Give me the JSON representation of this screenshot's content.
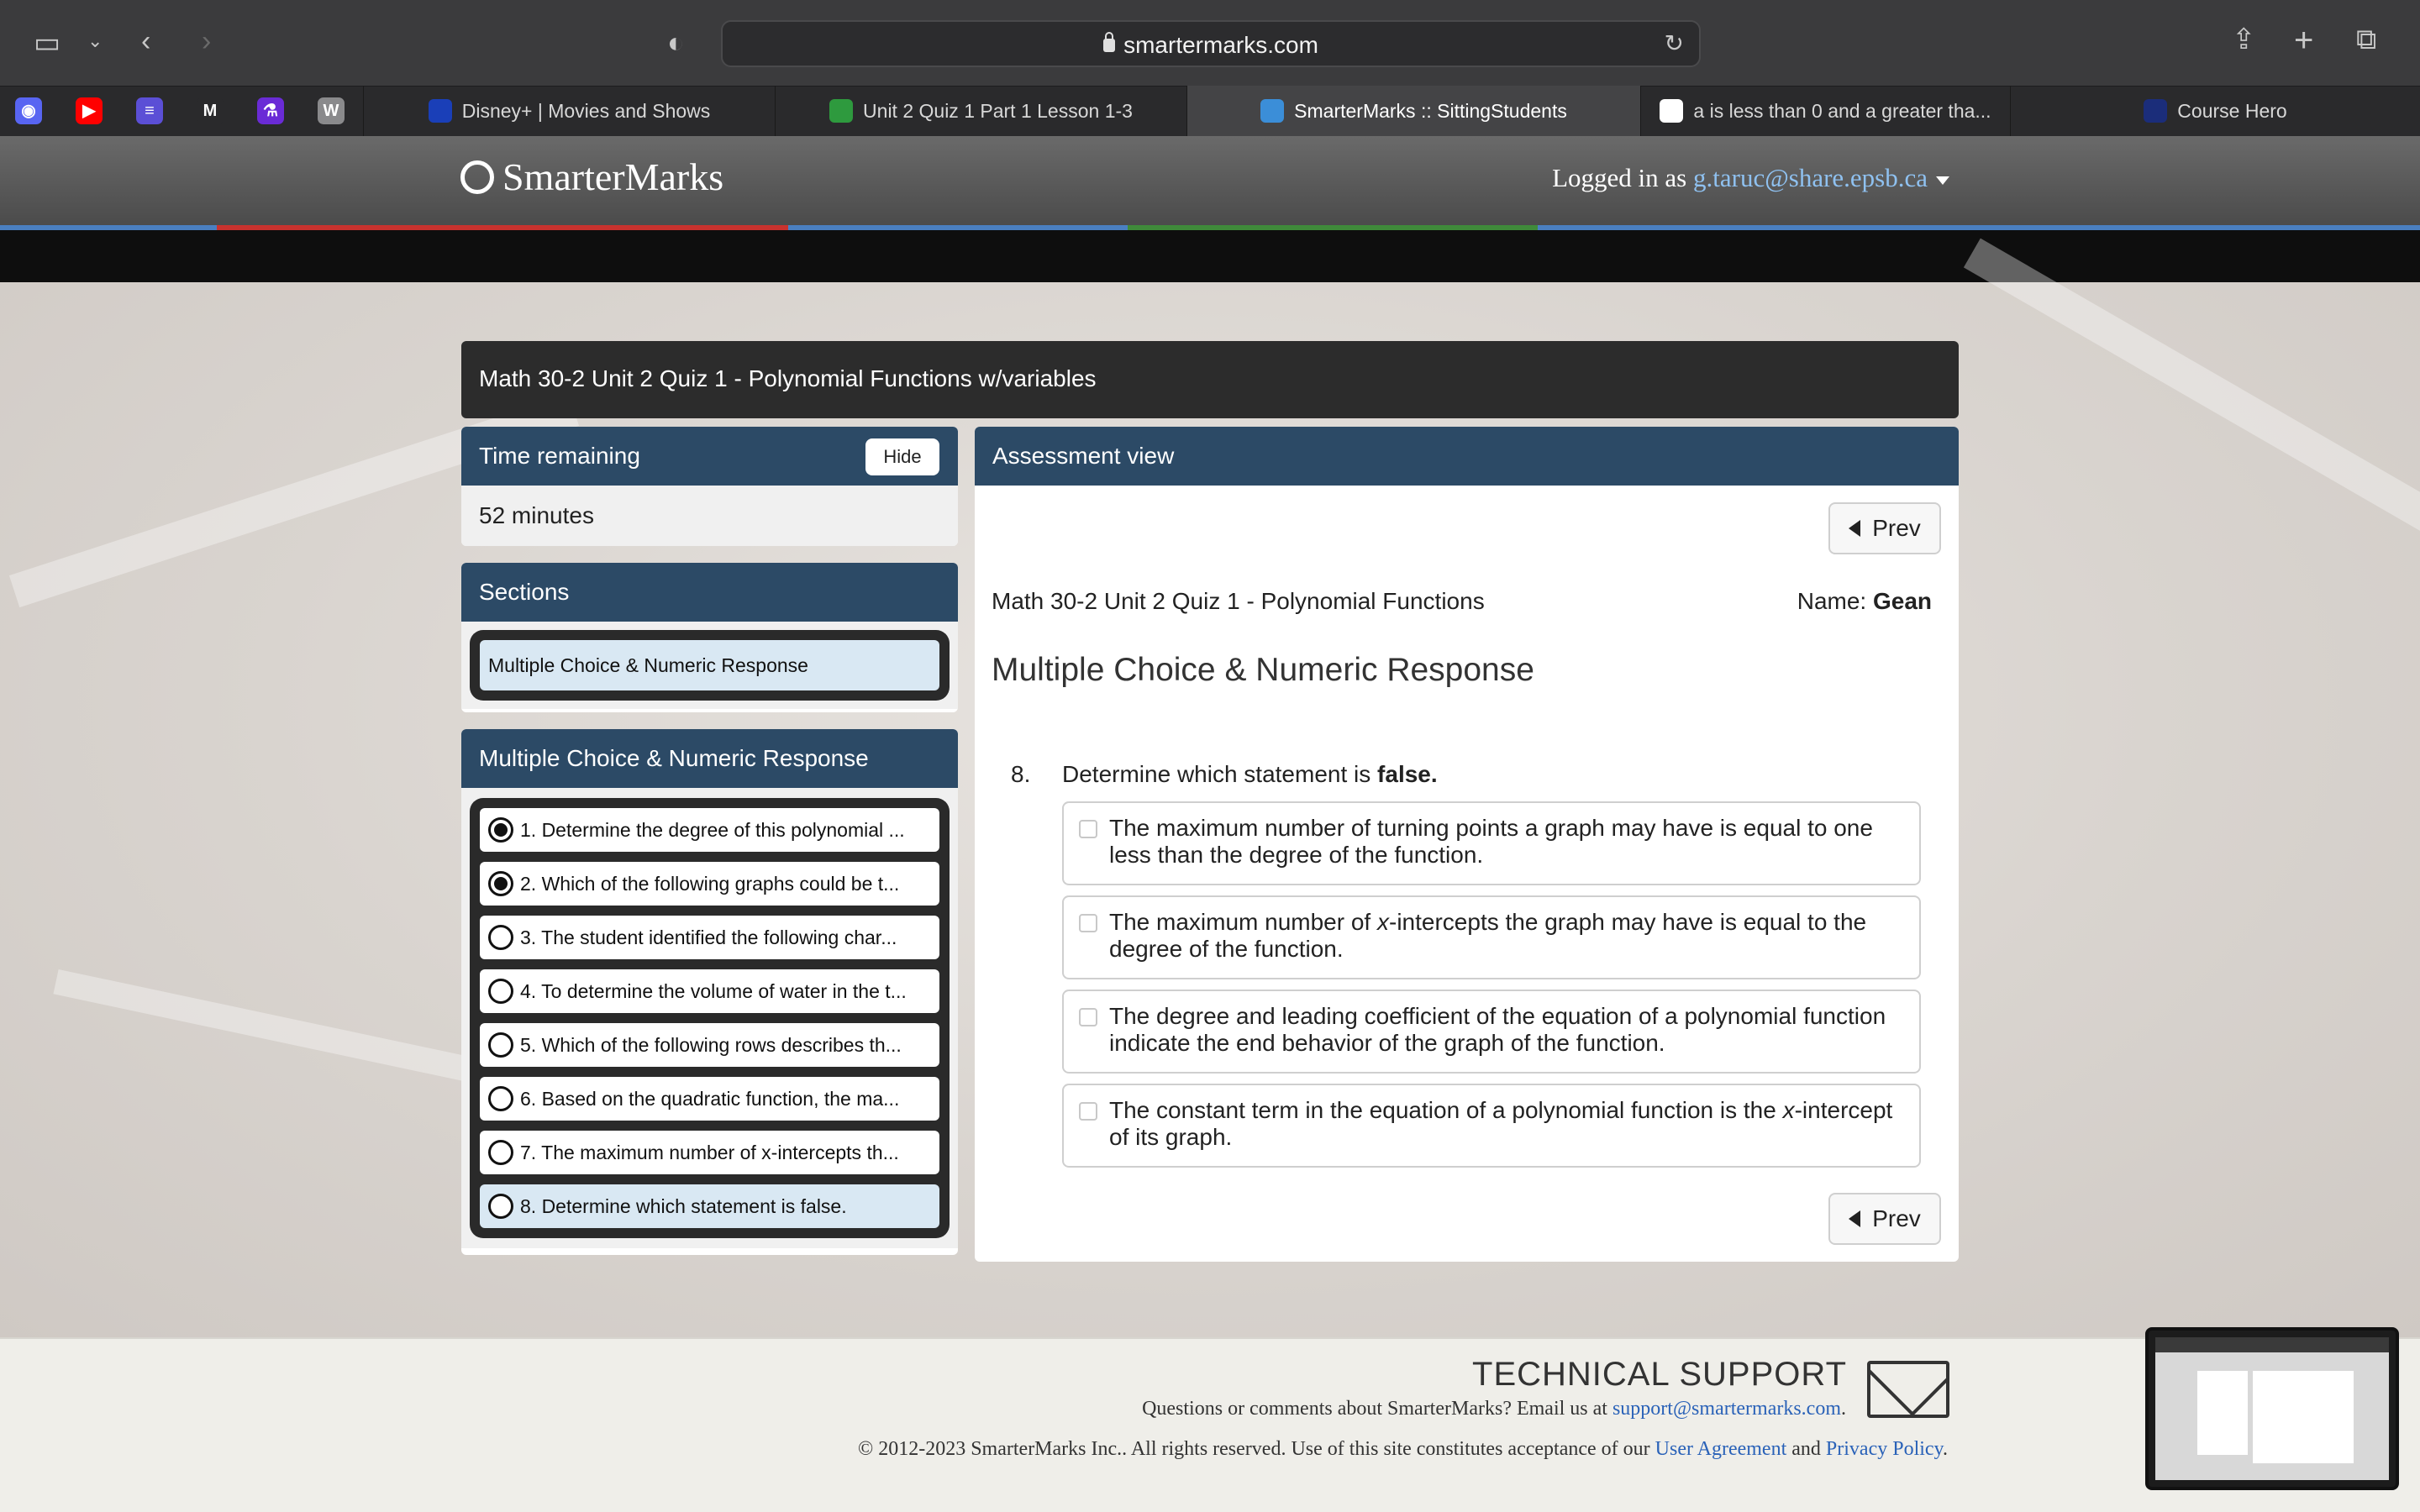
{
  "browser": {
    "url": "smartermarks.com",
    "favorites": [
      {
        "name": "discord",
        "color": "#5865f2",
        "glyph": "◉"
      },
      {
        "name": "youtube",
        "color": "#ff0000",
        "glyph": "▶"
      },
      {
        "name": "tasks",
        "color": "#5b4fd6",
        "glyph": "≡"
      },
      {
        "name": "gmail",
        "color": "#2a2a2c",
        "glyph": "M"
      },
      {
        "name": "lab",
        "color": "#6a2bd6",
        "glyph": "⚗"
      },
      {
        "name": "word",
        "color": "#8a8a8c",
        "glyph": "W"
      }
    ],
    "tabs": [
      {
        "label": "Disney+ | Movies and Shows",
        "icon_color": "#1a3fb8"
      },
      {
        "label": "Unit 2 Quiz 1 Part 1 Lesson 1-3",
        "icon_color": "#2e9a3e"
      },
      {
        "label": "SmarterMarks :: SittingStudents",
        "icon_color": "#3b8ed8",
        "active": true
      },
      {
        "label": "a is less than 0 and a greater tha...",
        "icon_color": "#ffffff"
      },
      {
        "label": "Course Hero",
        "icon_color": "#1b2d7a"
      }
    ]
  },
  "site": {
    "logo": "SmarterMarks",
    "login_prefix": "Logged in as",
    "login_user": "g.taruc@share.epsb.ca"
  },
  "quiz": {
    "title": "Math 30-2 Unit 2 Quiz 1 - Polynomial Functions w/variables"
  },
  "timer": {
    "header": "Time remaining",
    "hide_label": "Hide",
    "value": "52 minutes"
  },
  "sections": {
    "header": "Sections",
    "items": [
      "Multiple Choice & Numeric Response"
    ]
  },
  "questions": {
    "header": "Multiple Choice & Numeric Response",
    "items": [
      {
        "label": "1. Determine the degree of this polynomial ...",
        "answered": true
      },
      {
        "label": "2. Which of the following graphs could be t...",
        "answered": true
      },
      {
        "label": "3. The student identified the following char...",
        "answered": false
      },
      {
        "label": "4. To determine the volume of water in the t...",
        "answered": false
      },
      {
        "label": "5. Which of the following rows describes th...",
        "answered": false
      },
      {
        "label": "6. Based on the quadratic function, the ma...",
        "answered": false
      },
      {
        "label": "7. The maximum number of x-intercepts th...",
        "answered": false
      },
      {
        "label": "8. Determine which statement is false.",
        "answered": false,
        "current": true
      }
    ]
  },
  "assessment": {
    "header": "Assessment view",
    "prev_label": "Prev",
    "quiz_name": "Math 30-2 Unit 2 Quiz 1 - Polynomial Functions",
    "name_label": "Name:",
    "student_name": "Gean",
    "section_title": "Multiple Choice & Numeric Response",
    "question_number": "8.",
    "question_text_prefix": "Determine which statement is",
    "question_text_bold": "false.",
    "options": [
      {
        "before": "The maximum number of turning points a graph may have is equal to one less than the degree of the function.",
        "italic": "",
        "after": ""
      },
      {
        "before": "The maximum number of ",
        "italic": "x",
        "after": "-intercepts the graph may have is equal to the degree of the function."
      },
      {
        "before": "The degree and leading coefficient of the equation of a polynomial function indicate the end behavior of the graph of the function.",
        "italic": "",
        "after": ""
      },
      {
        "before": "The constant term in the equation of a polynomial function is the ",
        "italic": "x",
        "after": "-intercept of its graph."
      }
    ]
  },
  "footer": {
    "tech_title": "TECHNICAL SUPPORT",
    "line1_prefix": "Questions or comments about SmarterMarks? Email us at",
    "email": "support@smartermarks.com",
    "line1_suffix": ".",
    "line2_prefix": "© 2012-2023 SmarterMarks Inc.. All rights reserved. Use of this site constitutes acceptance of our",
    "user_agreement": "User Agreement",
    "and": "and",
    "privacy": "Privacy Policy",
    "line2_suffix": "."
  },
  "colors": {
    "panel_header": "#2c4a66",
    "link": "#2a62b8",
    "highlight": "#d9e8f3"
  }
}
